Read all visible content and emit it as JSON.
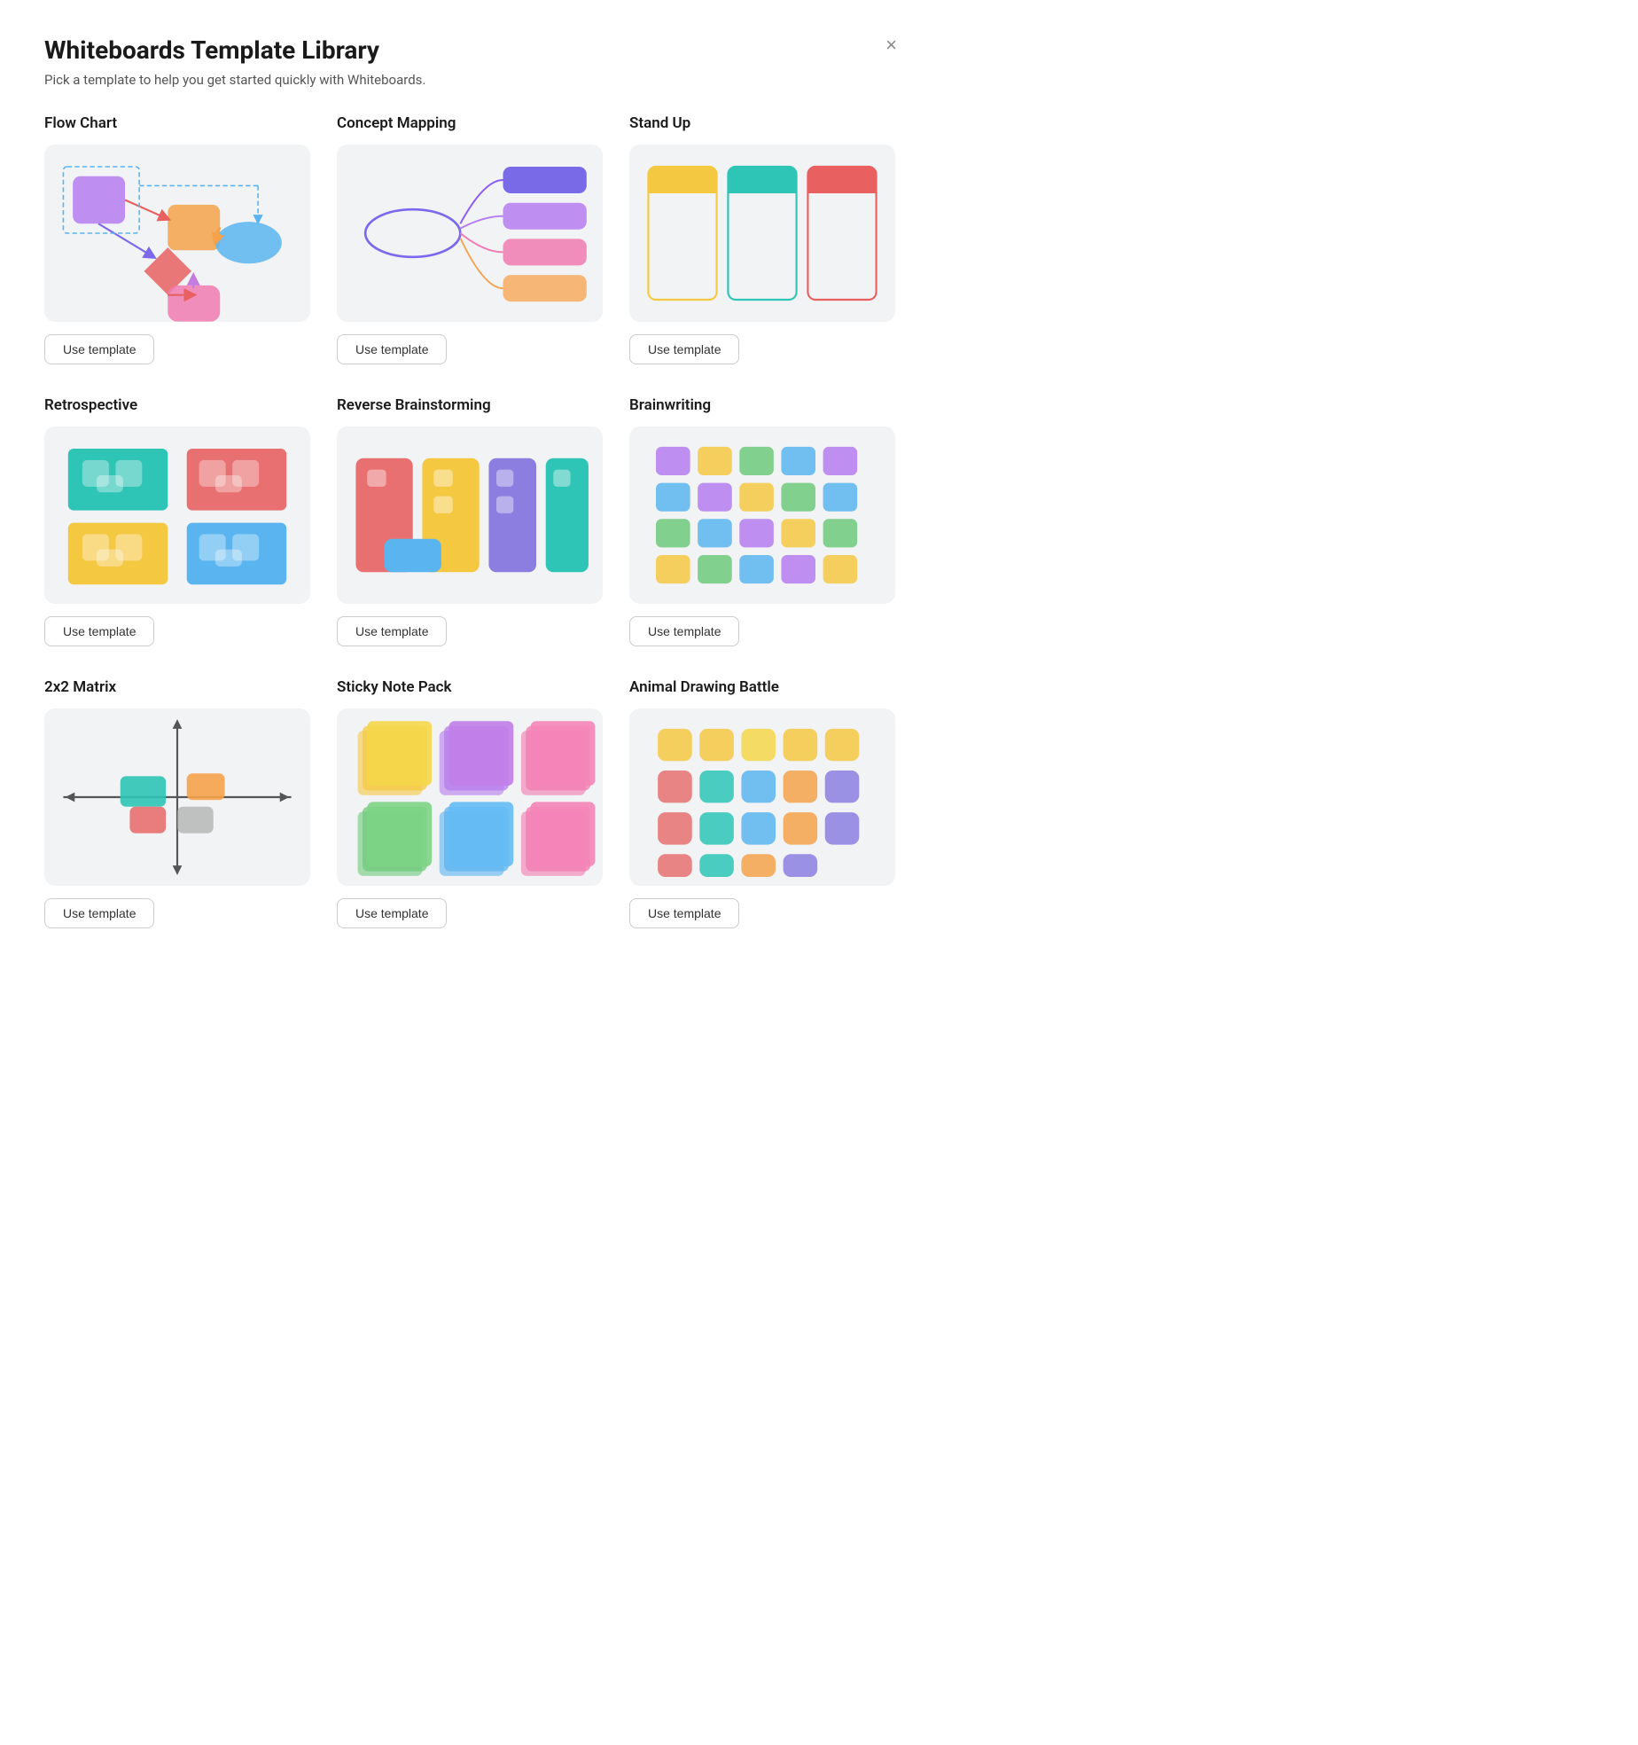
{
  "dialog": {
    "title": "Whiteboards Template Library",
    "subtitle": "Pick a template to help you get started quickly with Whiteboards.",
    "close_label": "×"
  },
  "templates": [
    {
      "id": "flow-chart",
      "name": "Flow Chart",
      "btn": "Use template"
    },
    {
      "id": "concept-mapping",
      "name": "Concept Mapping",
      "btn": "Use template"
    },
    {
      "id": "stand-up",
      "name": "Stand Up",
      "btn": "Use template"
    },
    {
      "id": "retrospective",
      "name": "Retrospective",
      "btn": "Use template"
    },
    {
      "id": "reverse-brainstorming",
      "name": "Reverse Brainstorming",
      "btn": "Use template"
    },
    {
      "id": "brainwriting",
      "name": "Brainwriting",
      "btn": "Use template"
    },
    {
      "id": "2x2-matrix",
      "name": "2x2 Matrix",
      "btn": "Use template"
    },
    {
      "id": "sticky-note-pack",
      "name": "Sticky Note Pack",
      "btn": "Use template"
    },
    {
      "id": "animal-drawing-battle",
      "name": "Animal Drawing Battle",
      "btn": "Use template"
    }
  ]
}
